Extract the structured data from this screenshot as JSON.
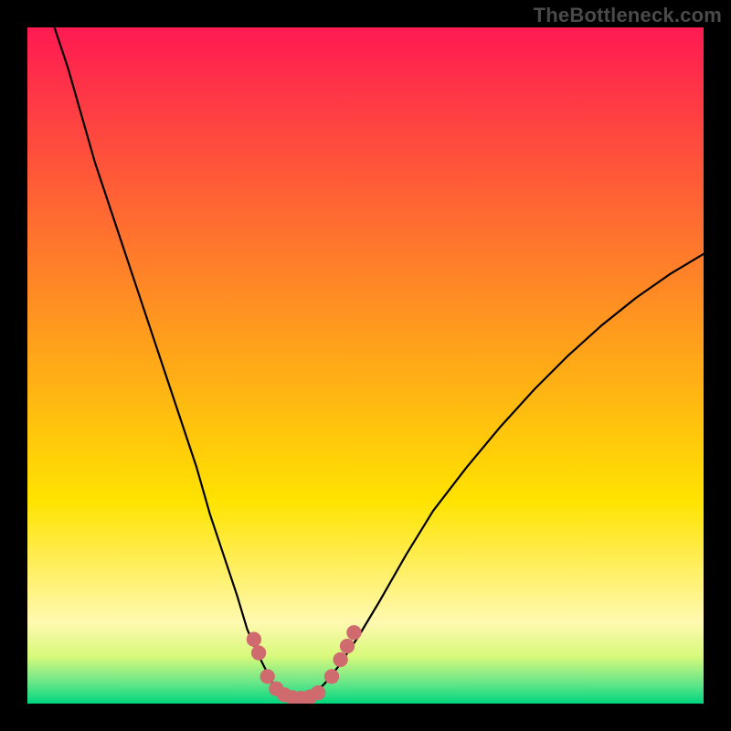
{
  "watermark": "TheBottleneck.com",
  "chart_data": {
    "type": "line",
    "title": "",
    "xlabel": "",
    "ylabel": "",
    "xlim": [
      0,
      100
    ],
    "ylim": [
      0,
      100
    ],
    "gradient_bands": [
      {
        "y_from": 100,
        "y_to": 30,
        "color_top": "#ff1a52",
        "color_bottom": "#ffe300"
      },
      {
        "y_from": 30,
        "y_to": 12,
        "color_top": "#ffe300",
        "color_bottom": "#fff9b0"
      },
      {
        "y_from": 12,
        "y_to": 7,
        "color_top": "#fff9b0",
        "color_bottom": "#d7f97a"
      },
      {
        "y_from": 7,
        "y_to": 3,
        "color_top": "#d7f97a",
        "color_bottom": "#66e689"
      },
      {
        "y_from": 3,
        "y_to": 0,
        "color_top": "#66e689",
        "color_bottom": "#00d67e"
      }
    ],
    "series": [
      {
        "name": "left-branch",
        "color": "#000000",
        "x": [
          4,
          6,
          8,
          10,
          13,
          16,
          19,
          22,
          25,
          27,
          29,
          31,
          32.5,
          34,
          35.5,
          36.5,
          37.5
        ],
        "y": [
          100,
          94,
          87,
          80,
          71,
          62,
          53,
          44,
          35,
          28,
          22,
          16,
          11,
          7.5,
          4.5,
          2.5,
          1.5
        ]
      },
      {
        "name": "valley",
        "color": "#000000",
        "x": [
          37.5,
          38.5,
          39.5,
          40.5,
          41.5,
          42.5
        ],
        "y": [
          1.5,
          1.0,
          0.8,
          0.8,
          1.0,
          1.5
        ]
      },
      {
        "name": "right-branch",
        "color": "#000000",
        "x": [
          42.5,
          44,
          46,
          49,
          52,
          56,
          60,
          65,
          70,
          75,
          80,
          85,
          90,
          95,
          100
        ],
        "y": [
          1.5,
          3,
          5.5,
          10,
          15,
          22,
          28.5,
          35,
          41,
          46.5,
          51.5,
          56,
          60,
          63.5,
          66.5
        ]
      }
    ],
    "markers": {
      "name": "highlight-dots",
      "color": "#cf6a6e",
      "radius": 1.1,
      "points": [
        {
          "x": 33.5,
          "y": 9.5
        },
        {
          "x": 34.2,
          "y": 7.5
        },
        {
          "x": 35.5,
          "y": 4.0
        },
        {
          "x": 36.8,
          "y": 2.2
        },
        {
          "x": 38.0,
          "y": 1.3
        },
        {
          "x": 39.2,
          "y": 0.9
        },
        {
          "x": 40.5,
          "y": 0.8
        },
        {
          "x": 41.8,
          "y": 1.0
        },
        {
          "x": 43.0,
          "y": 1.6
        },
        {
          "x": 45.0,
          "y": 4.0
        },
        {
          "x": 46.3,
          "y": 6.5
        },
        {
          "x": 47.3,
          "y": 8.5
        },
        {
          "x": 48.3,
          "y": 10.5
        }
      ]
    }
  }
}
